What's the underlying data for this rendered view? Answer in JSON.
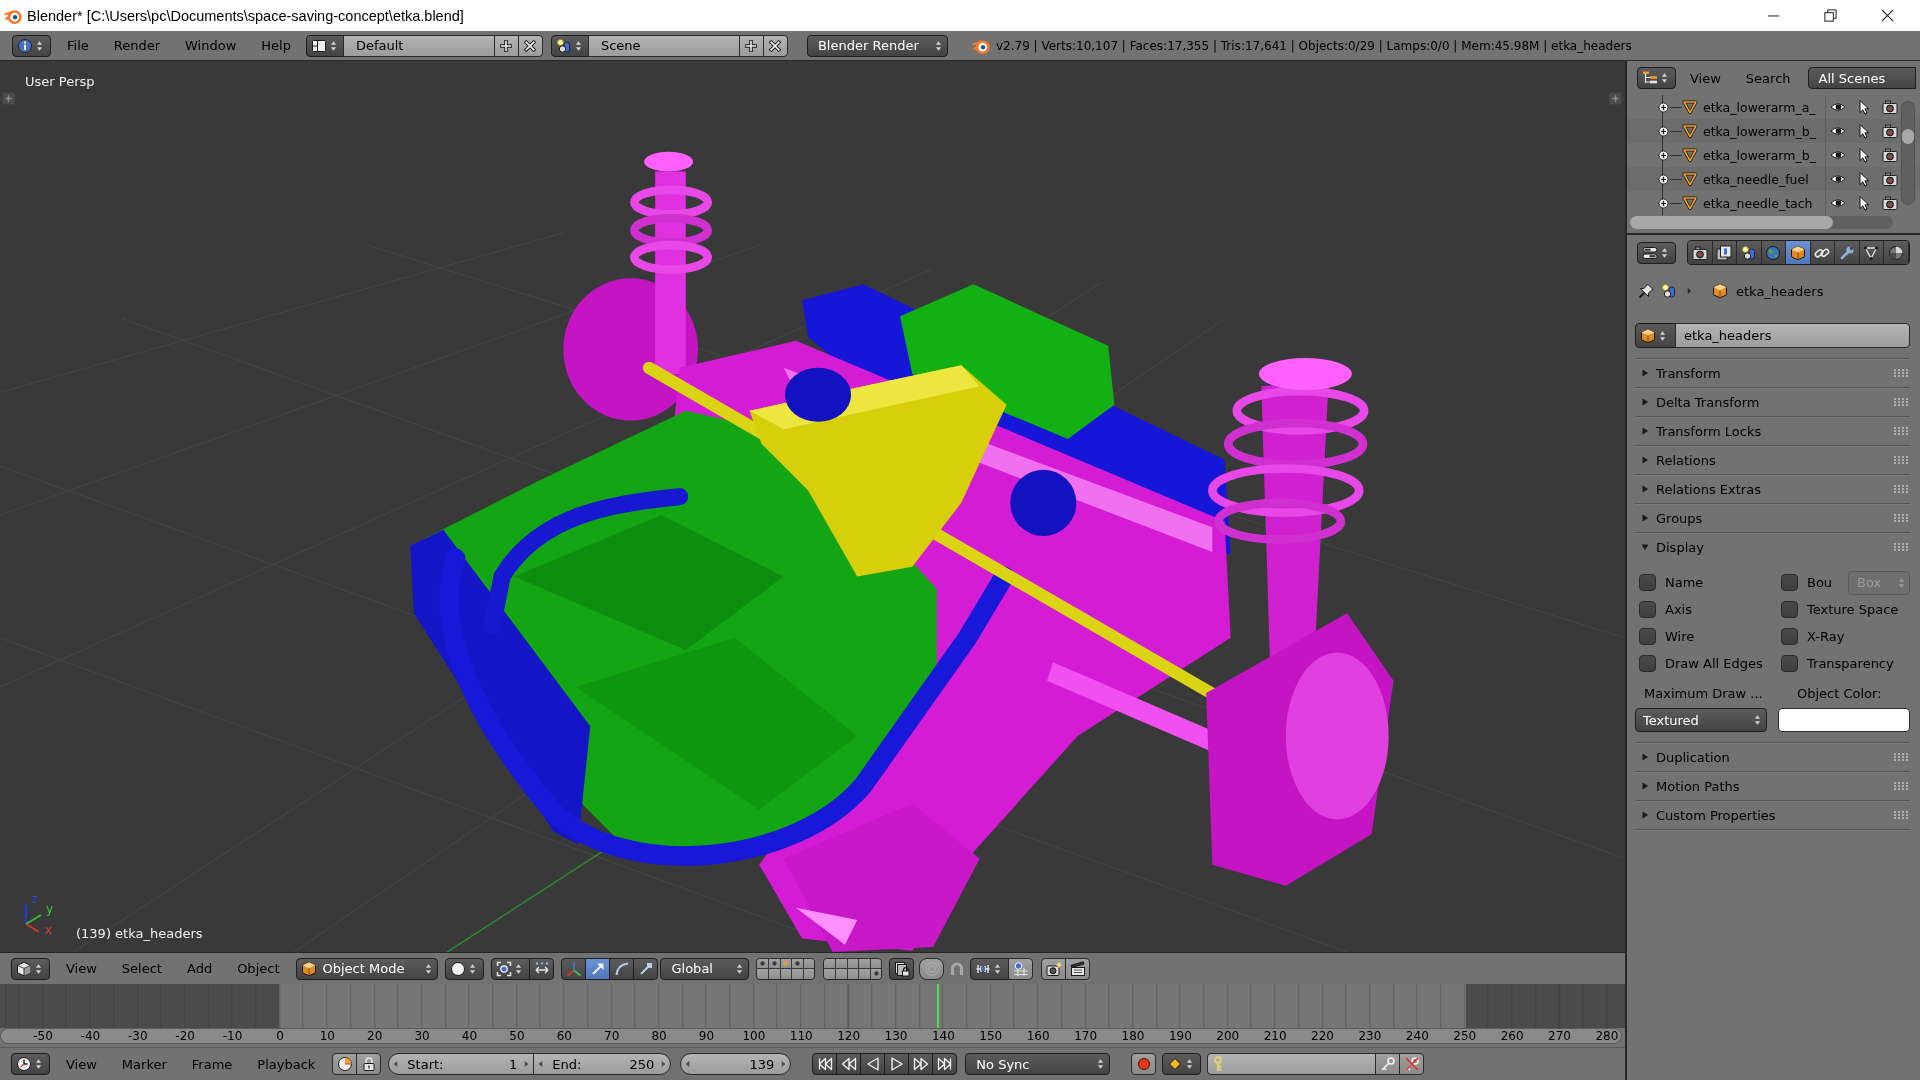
{
  "window": {
    "title": "Blender* [C:\\Users\\pc\\Documents\\space-saving-concept\\etka.blend]"
  },
  "info_header": {
    "menus": [
      "File",
      "Render",
      "Window",
      "Help"
    ],
    "screen_layout": "Default",
    "scene": "Scene",
    "render_engine": "Blender Render",
    "stats": "v2.79 | Verts:10,107 | Faces:17,355 | Tris:17,641 | Objects:0/29 | Lamps:0/0 | Mem:45.98M | etka_headers"
  },
  "viewport": {
    "view_name": "User Persp",
    "axes": [
      {
        "kind": "z",
        "label": "z"
      },
      {
        "kind": "y",
        "label": "y"
      },
      {
        "kind": "x",
        "label": "x"
      }
    ],
    "status": "(139) etka_headers"
  },
  "view3d_header": {
    "menus": [
      "View",
      "Select",
      "Add",
      "Object"
    ],
    "mode": "Object Mode",
    "transform_tools": [
      {
        "kind": "translate",
        "selected": true
      },
      {
        "kind": "rotate",
        "selected": false
      },
      {
        "kind": "scale",
        "selected": false
      }
    ],
    "orientation": "Global",
    "layer_groups": [
      {
        "layers": [
          {
            "kind": "used"
          },
          {
            "kind": "used"
          },
          {
            "kind": "active"
          },
          {
            "kind": "used"
          },
          {
            "kind": "empty"
          },
          {
            "kind": "empty"
          },
          {
            "kind": "empty"
          },
          {
            "kind": "empty"
          },
          {
            "kind": "empty"
          },
          {
            "kind": "empty"
          }
        ]
      },
      {
        "layers": [
          {
            "kind": "empty"
          },
          {
            "kind": "empty"
          },
          {
            "kind": "empty"
          },
          {
            "kind": "empty"
          },
          {
            "kind": "empty"
          },
          {
            "kind": "empty"
          },
          {
            "kind": "empty"
          },
          {
            "kind": "empty"
          },
          {
            "kind": "empty"
          },
          {
            "kind": "used"
          }
        ]
      }
    ]
  },
  "timeline": {
    "ruler": [
      "-50",
      "-40",
      "-30",
      "-20",
      "-10",
      "0",
      "10",
      "20",
      "30",
      "40",
      "50",
      "60",
      "70",
      "80",
      "90",
      "100",
      "110",
      "120",
      "130",
      "140",
      "150",
      "160",
      "170",
      "180",
      "190",
      "200",
      "210",
      "220",
      "230",
      "240",
      "250",
      "260",
      "270",
      "280"
    ],
    "playhead": {
      "level": 0.577
    }
  },
  "timeline_header": {
    "menus": [
      "View",
      "Marker",
      "Frame",
      "Playback"
    ],
    "start": {
      "label": "Start:",
      "value": "1"
    },
    "end": {
      "label": "End:",
      "value": "250"
    },
    "current_frame": "139",
    "sync": "No Sync"
  },
  "outliner": {
    "menus": [
      "View",
      "Search"
    ],
    "display_mode": "All Scenes",
    "items": [
      {
        "name": "etka_lowerarm_a_"
      },
      {
        "name": "etka_lowerarm_b_"
      },
      {
        "name": "etka_lowerarm_b_"
      },
      {
        "name": "etka_needle_fuel"
      },
      {
        "name": "etka_needle_tach"
      }
    ]
  },
  "properties": {
    "tabs": [
      {
        "kind": "render",
        "selected": false
      },
      {
        "kind": "render_layers",
        "selected": false
      },
      {
        "kind": "scene",
        "selected": false
      },
      {
        "kind": "world",
        "selected": false
      },
      {
        "kind": "object",
        "selected": true
      },
      {
        "kind": "constraints",
        "selected": false
      },
      {
        "kind": "modifiers",
        "selected": false
      },
      {
        "kind": "data",
        "selected": false
      },
      {
        "kind": "material",
        "selected": false
      }
    ],
    "breadcrumb": "etka_headers",
    "object_name": "etka_headers",
    "panels": [
      {
        "title": "Transform",
        "expanded": false
      },
      {
        "title": "Delta Transform",
        "expanded": false
      },
      {
        "title": "Transform Locks",
        "expanded": false
      },
      {
        "title": "Relations",
        "expanded": false
      },
      {
        "title": "Relations Extras",
        "expanded": false
      },
      {
        "title": "Groups",
        "expanded": false
      },
      {
        "title": "Display",
        "expanded": true,
        "options": [
          {
            "label": "Name",
            "checked": false
          },
          {
            "label": "Bou",
            "checked": false,
            "dropdown": {
              "value": "Box",
              "disabled": true
            }
          },
          {
            "label": "Axis",
            "checked": false
          },
          {
            "label": "Texture Space",
            "checked": false
          },
          {
            "label": "Wire",
            "checked": false
          },
          {
            "label": "X-Ray",
            "checked": false
          },
          {
            "label": "Draw All Edges",
            "checked": false
          },
          {
            "label": "Transparency",
            "checked": false
          }
        ],
        "max_draw_label": "Maximum Draw ...",
        "max_draw_type": "Textured",
        "color_label": "Object Color:"
      },
      {
        "title": "Duplication",
        "expanded": false
      },
      {
        "title": "Motion Paths",
        "expanded": false
      },
      {
        "title": "Custom Properties",
        "expanded": false
      }
    ]
  }
}
